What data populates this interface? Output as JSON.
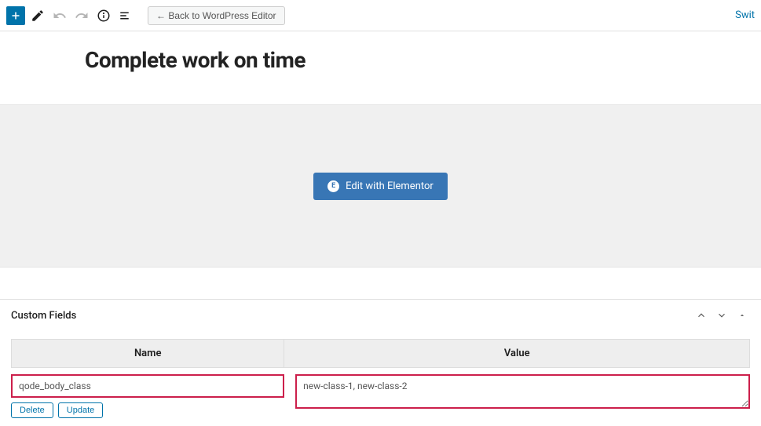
{
  "toolbar": {
    "back_label": "← Back to WordPress Editor",
    "switch_label": "Swit"
  },
  "page": {
    "title": "Complete work on time"
  },
  "elementor": {
    "button_label": "Edit with Elementor"
  },
  "custom_fields": {
    "panel_title": "Custom Fields",
    "col_name": "Name",
    "col_value": "Value",
    "rows": [
      {
        "name": "qode_body_class",
        "value": "new-class-1, new-class-2"
      }
    ],
    "delete_label": "Delete",
    "update_label": "Update"
  }
}
